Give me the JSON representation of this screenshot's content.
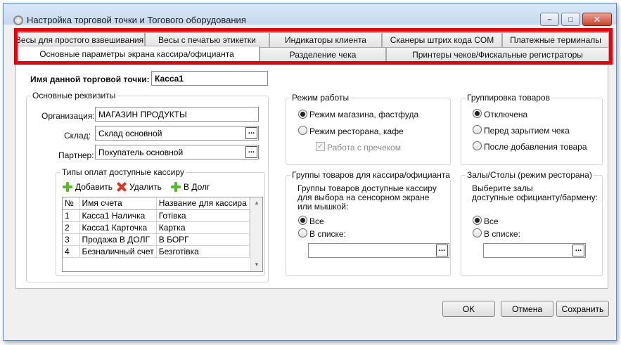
{
  "window": {
    "title": "Настройка торговой точки и Тогового оборудования",
    "minimize_glyph": "–",
    "maximize_glyph": "□",
    "close_glyph": "✕"
  },
  "tabs": {
    "row1": [
      "Весы для простого взвешивания",
      "Весы с печатью этикетки",
      "Индикаторы клиента",
      "Сканеры штрих кода COM",
      "Платежные терминалы"
    ],
    "row2": [
      "Основные параметры экрана кассира/официанта",
      "Разделение чека",
      "Принтеры чеков/Фискальные регистраторы"
    ]
  },
  "highlight_color": "#e8000b",
  "point_name": {
    "label": "Имя данной торговой точки:",
    "value": "Касса1"
  },
  "requisites": {
    "title": "Основные реквизиты",
    "organization_label": "Организация:",
    "organization_value": "МАГАЗИН ПРОДУКТЫ",
    "warehouse_label": "Склад:",
    "warehouse_value": "Склад основной",
    "partner_label": "Партнер:",
    "partner_value": "Покупатель основной",
    "dots": "..."
  },
  "payment_types": {
    "title": "Типы оплат доступные кассиру",
    "add_label": "Добавить",
    "delete_label": "Удалить",
    "credit_label": "В Долг",
    "columns": [
      "№",
      "Имя счета",
      "Название для кассира"
    ],
    "rows": [
      [
        "1",
        "Касса1 Наличка",
        "Готівка"
      ],
      [
        "2",
        "Касса1 Карточка",
        "Картка"
      ],
      [
        "3",
        "Продажа В ДОЛГ",
        "В БОРГ"
      ],
      [
        "4",
        "Безналичный счет",
        "Безготівка"
      ]
    ]
  },
  "work_mode": {
    "title": "Режим работы",
    "option_shop": "Режим магазина, фастфуда",
    "option_restaurant": "Режим ресторана, кафе",
    "with_precheck": "Работа с пречеком",
    "check_glyph": "✓"
  },
  "grouping": {
    "title": "Группировка товаров",
    "option_off": "Отключена",
    "option_before_close": "Перед зарытием чека",
    "option_after_add": "После добавления товара"
  },
  "product_groups": {
    "title": "Группы товаров для кассира/официанта",
    "description": [
      "Группы товаров доступные кассиру",
      "для выбора на сенсорном экране",
      "или мышкой:"
    ],
    "option_all": "Все",
    "option_list": "В списке:",
    "dots": "..."
  },
  "halls": {
    "title": "Залы/Столы (режим ресторана)",
    "description": [
      "Выберите залы",
      "доступные официанту/бармену:"
    ],
    "option_all": "Все",
    "option_list": "В списке:",
    "dots": "..."
  },
  "buttons": {
    "ok": "OK",
    "cancel": "Отмена",
    "save": "Сохранить"
  }
}
